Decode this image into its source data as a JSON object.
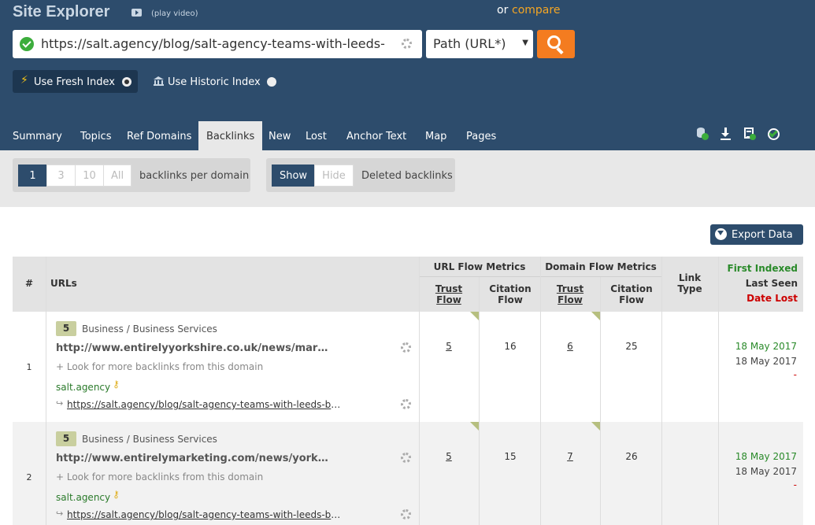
{
  "header": {
    "title": "Site Explorer",
    "play_video": "(play video)",
    "or_label": "or",
    "compare_label": "compare",
    "url_value": "https://salt.agency/blog/salt-agency-teams-with-leeds-",
    "scope_select": "Path (URL*)",
    "fresh_index": "Use Fresh Index",
    "historic_index": "Use Historic Index",
    "tabs": [
      "Summary",
      "Topics",
      "Ref Domains",
      "Backlinks",
      "New",
      "Lost",
      "Anchor Text",
      "Map",
      "Pages"
    ],
    "active_tab": "Backlinks"
  },
  "filters": {
    "per_domain_options": [
      "1",
      "3",
      "10",
      "All"
    ],
    "per_domain_selected": "1",
    "per_domain_label": "backlinks per domain",
    "deleted_options": [
      "Show",
      "Hide"
    ],
    "deleted_selected": "Show",
    "deleted_label": "Deleted backlinks"
  },
  "export_label": "Export Data",
  "table": {
    "headers": {
      "num": "#",
      "urls": "URLs",
      "url_flow_metrics": "URL Flow Metrics",
      "domain_flow_metrics": "Domain Flow Metrics",
      "trust_flow": "Trust Flow",
      "citation_flow": "Citation Flow",
      "link_type": "Link Type",
      "first_indexed": "First Indexed",
      "last_seen": "Last Seen",
      "date_lost": "Date Lost"
    },
    "rows": [
      {
        "num": "1",
        "badge": "5",
        "category": "Business / Business Services",
        "source_url": "http://www.entirelyyorkshire.co.uk/news/marketi...",
        "look_more": "+ Look for more backlinks from this domain",
        "target_domain": "salt.agency",
        "target_url": "https://salt.agency/blog/salt-agency-teams-with-leeds-bec...",
        "url_tf": "5",
        "url_cf": "16",
        "domain_tf": "6",
        "domain_cf": "25",
        "first_indexed": "18 May 2017",
        "last_seen": "18 May 2017",
        "date_lost": "-"
      },
      {
        "num": "2",
        "badge": "5",
        "category": "Business / Business Services",
        "source_url": "http://www.entirelymarketing.com/news/yorkshire...",
        "look_more": "+ Look for more backlinks from this domain",
        "target_domain": "salt.agency",
        "target_url": "https://salt.agency/blog/salt-agency-teams-with-leeds-bec...",
        "url_tf": "5",
        "url_cf": "15",
        "domain_tf": "7",
        "domain_cf": "26",
        "first_indexed": "18 May 2017",
        "last_seen": "18 May 2017",
        "date_lost": "-"
      }
    ]
  }
}
